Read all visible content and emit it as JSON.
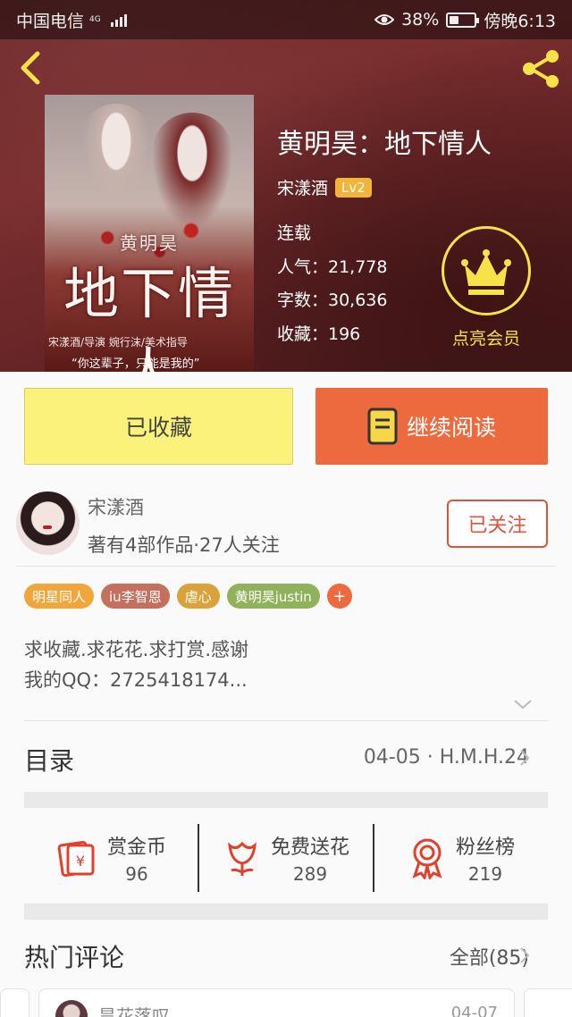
{
  "status_bar": {
    "carrier": "中国电信",
    "network": "4G",
    "battery": "38%",
    "battery_level": 0.38,
    "time": "傍晚6:13"
  },
  "book": {
    "title": "黄明昊：地下情人",
    "author": "宋漾酒",
    "level": "Lv2",
    "status": "连载",
    "popularity": "人气：21,778",
    "word_count": "字数：30,636",
    "favorites": "收藏：196"
  },
  "cover": {
    "small_title": "黄明昊",
    "big_title": "地下情人",
    "credit": "宋漾酒/导演    婉行沫/美术指导",
    "quote": "“你这辈子，只能是我的”"
  },
  "vip": {
    "label": "点亮会员"
  },
  "actions": {
    "favorited": "已收藏",
    "continue_reading": "继续阅读"
  },
  "author_card": {
    "name": "宋漾酒",
    "stats": "著有4部作品·27人关注",
    "follow": "已关注"
  },
  "tags": [
    {
      "label": "明星同人",
      "color": "#f0a63a"
    },
    {
      "label": "iu李智恩",
      "color": "#c5705e"
    },
    {
      "label": "虐心",
      "color": "#d9a23a"
    },
    {
      "label": "黄明昊justin",
      "color": "#8fb25a"
    }
  ],
  "tag_add": "+",
  "description": {
    "line1": "求收藏.求花花.求打赏.感谢",
    "line2": "我的QQ：2725418174..."
  },
  "catalog": {
    "title": "目录",
    "latest": "04-05 · H.M.H.24"
  },
  "stats": [
    {
      "label": "赏金币",
      "value": "96",
      "icon": "red-envelope-icon"
    },
    {
      "label": "免费送花",
      "value": "289",
      "icon": "flower-icon"
    },
    {
      "label": "粉丝榜",
      "value": "219",
      "icon": "medal-icon"
    }
  ],
  "comments": {
    "title": "热门评论",
    "all": "全部(85)",
    "first": {
      "name": "昙花落叹",
      "date": "04-07"
    }
  },
  "colors": {
    "accent_orange": "#ec6a3e",
    "favorite_yellow": "#faf27a",
    "vip_gold": "#f7e24a",
    "follow_red": "#e0533a"
  }
}
